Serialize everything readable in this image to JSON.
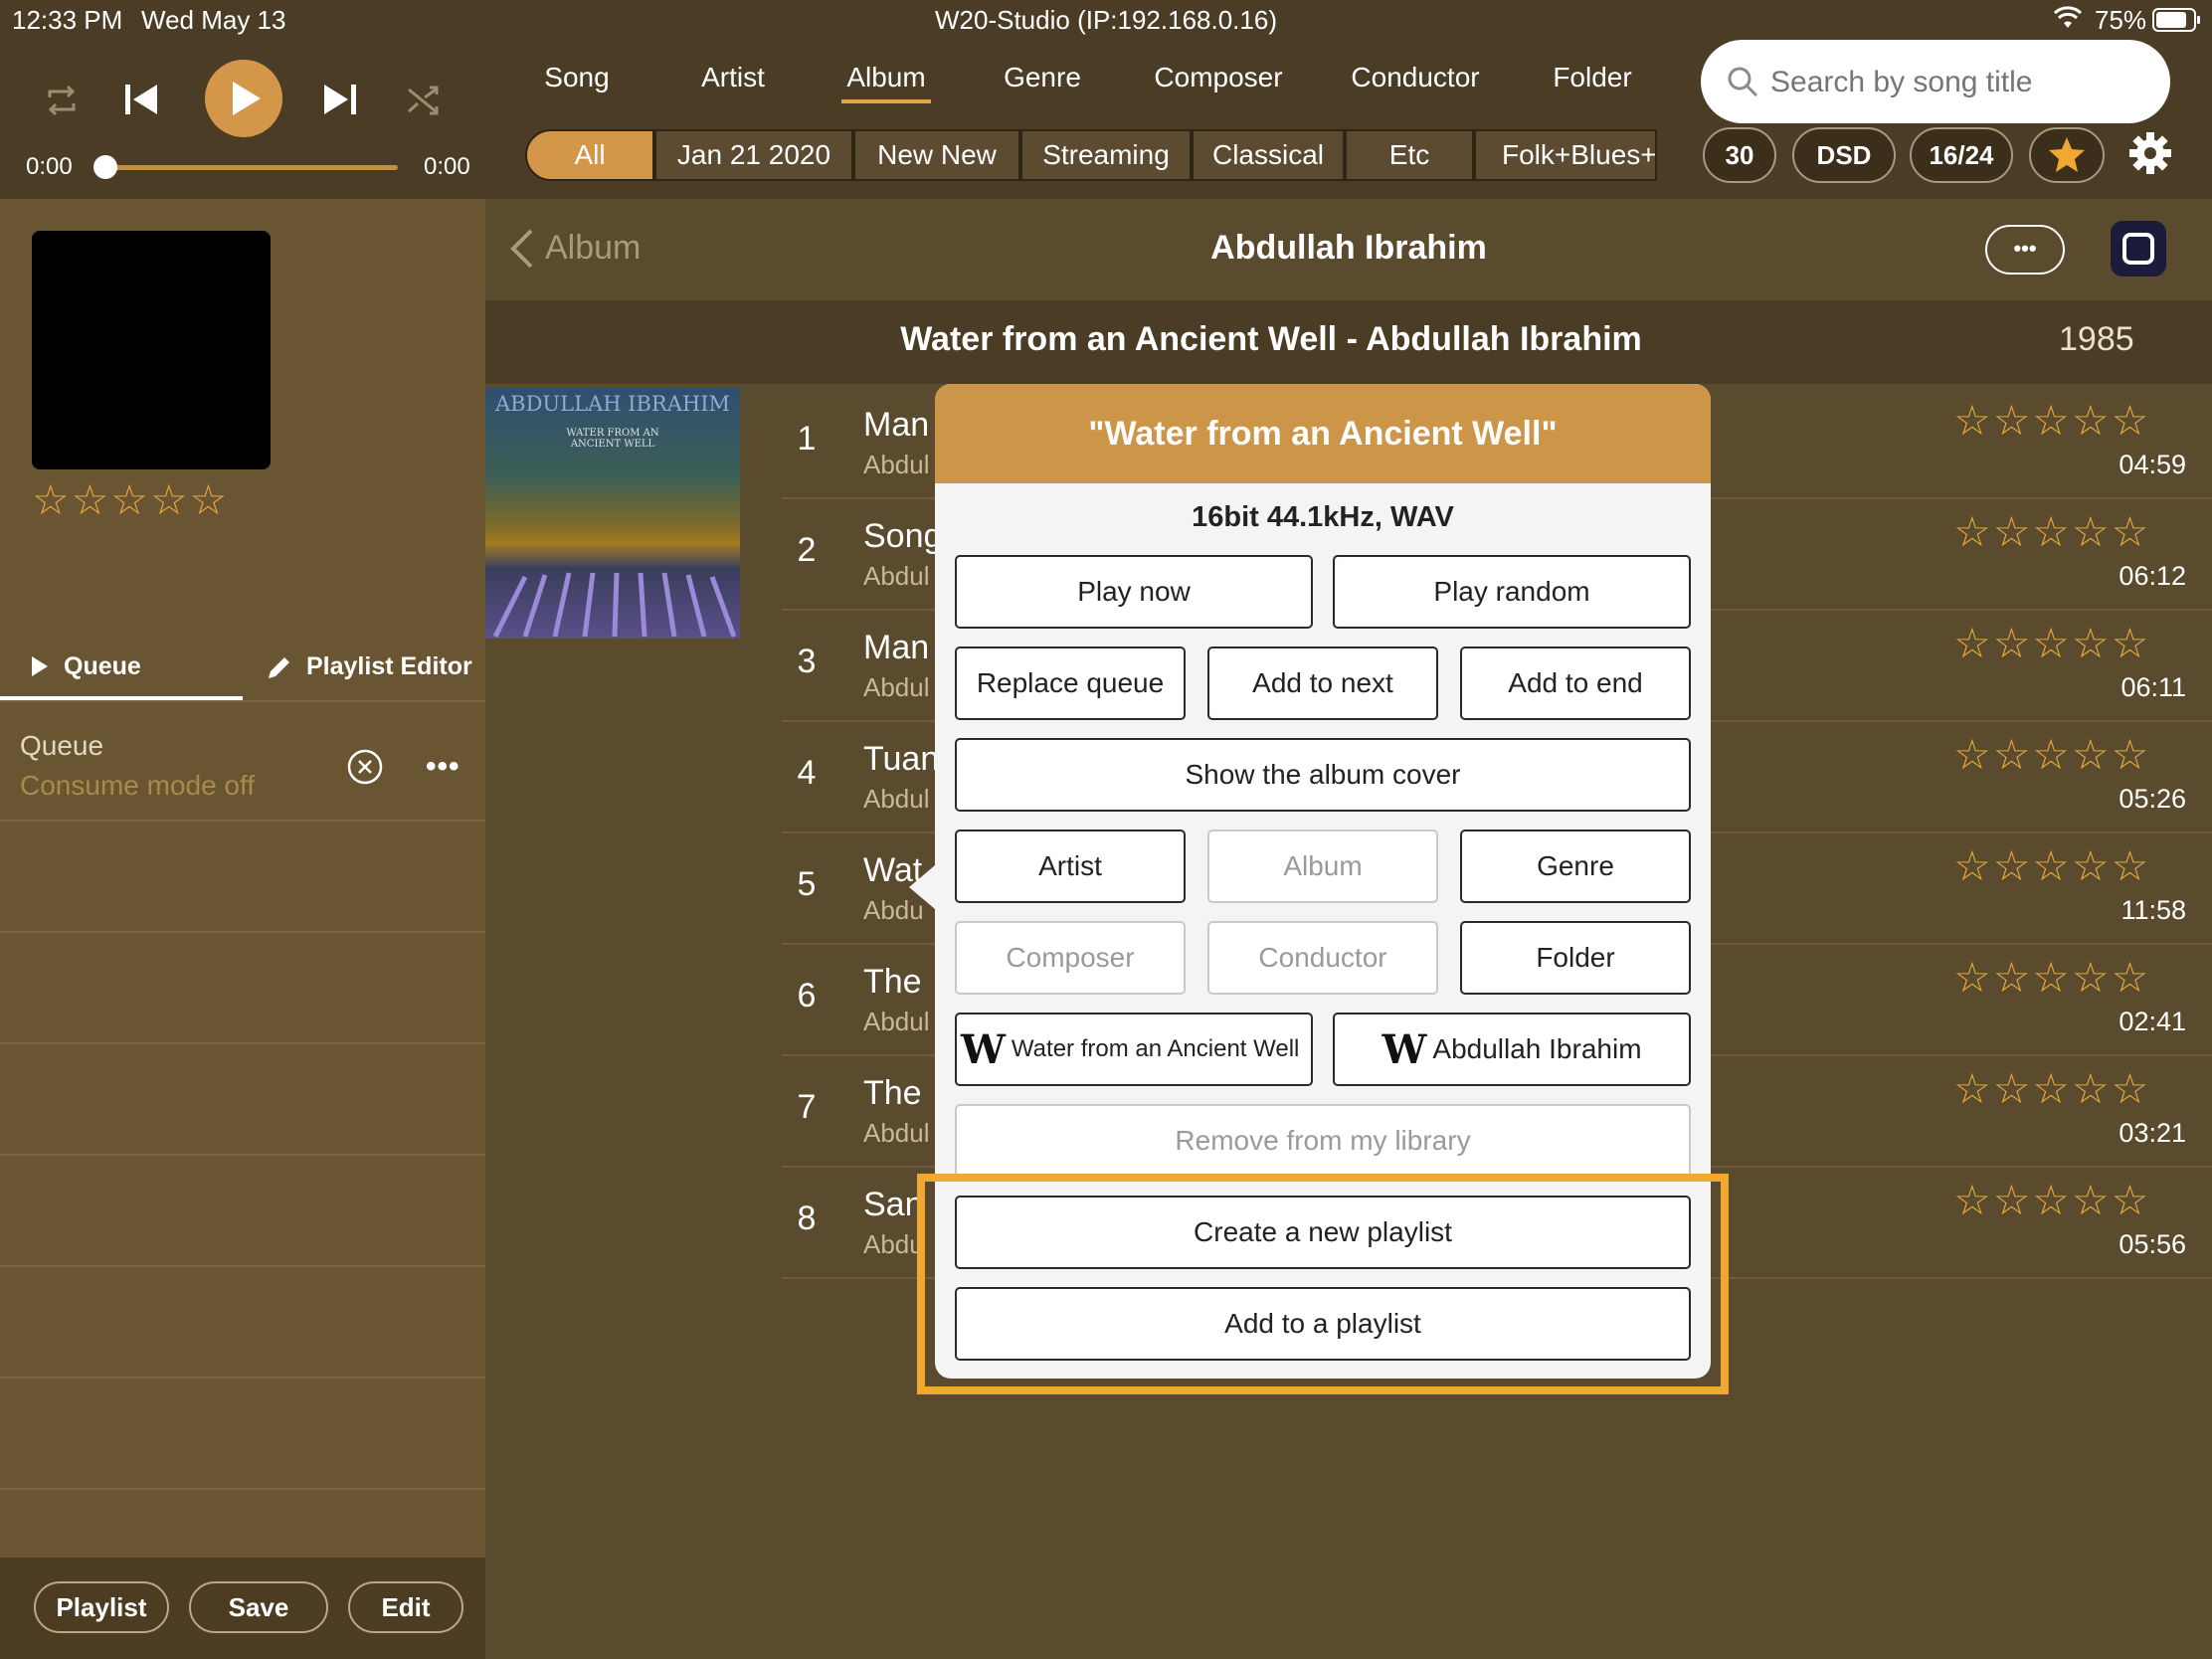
{
  "status_bar": {
    "time": "12:33 PM",
    "date": "Wed May 13",
    "device": "W20-Studio (IP:192.168.0.16)",
    "battery": "75%"
  },
  "player": {
    "elapsed": "0:00",
    "total": "0:00",
    "progress": 0
  },
  "nav_tabs": [
    "Song",
    "Artist",
    "Album",
    "Genre",
    "Composer",
    "Conductor",
    "Folder"
  ],
  "active_tab": "Album",
  "filter_chips": [
    "All",
    "Jan 21 2020",
    "New New",
    "Streaming",
    "Classical",
    "Etc",
    "Folk+Blues+C"
  ],
  "search": {
    "placeholder": "Search by song title"
  },
  "quick_pills": [
    "30",
    "DSD",
    "16/24"
  ],
  "left": {
    "queue_tab": "Queue",
    "editor_tab": "Playlist Editor",
    "queue_title": "Queue",
    "consume": "Consume mode off",
    "footer": [
      "Playlist",
      "Save",
      "Edit"
    ]
  },
  "header": {
    "back": "Album",
    "title": "Abdullah Ibrahim"
  },
  "album": {
    "title": "Water from an Ancient Well - Abdullah Ibrahim",
    "year": "1985",
    "cover_artist": "ABDULLAH IBRAHIM",
    "cover_title": "WATER FROM AN ANCIENT WELL"
  },
  "tracks": [
    {
      "num": "1",
      "title": "Man",
      "artist": "Abdul",
      "dur": "04:59"
    },
    {
      "num": "2",
      "title": "Song",
      "artist": "Abdul",
      "dur": "06:12"
    },
    {
      "num": "3",
      "title": "Man",
      "artist": "Abdul",
      "dur": "06:11"
    },
    {
      "num": "4",
      "title": "Tuan",
      "artist": "Abdul",
      "dur": "05:26"
    },
    {
      "num": "5",
      "title": "Wat",
      "artist": "Abdu",
      "dur": "11:58"
    },
    {
      "num": "6",
      "title": "The",
      "artist": "Abdul",
      "dur": "02:41"
    },
    {
      "num": "7",
      "title": "The",
      "artist": "Abdul",
      "dur": "03:21"
    },
    {
      "num": "8",
      "title": "San",
      "artist": "Abdu",
      "dur": "05:56"
    }
  ],
  "modal": {
    "title": "\"Water from an Ancient Well\"",
    "format": "16bit 44.1kHz, WAV",
    "play_now": "Play now",
    "play_random": "Play random",
    "replace_queue": "Replace queue",
    "add_next": "Add to next",
    "add_end": "Add to end",
    "show_cover": "Show the album cover",
    "artist": "Artist",
    "album": "Album",
    "genre": "Genre",
    "composer": "Composer",
    "conductor": "Conductor",
    "folder": "Folder",
    "wiki_album": "Water from an Ancient Well",
    "wiki_artist": "Abdullah Ibrahim",
    "wiki_glyph": "W",
    "remove": "Remove from my library",
    "create_playlist": "Create a new playlist",
    "add_playlist": "Add to a playlist"
  },
  "colors": {
    "accent": "#d4974a",
    "star": "#e3a63c",
    "highlight": "#f0a830"
  }
}
